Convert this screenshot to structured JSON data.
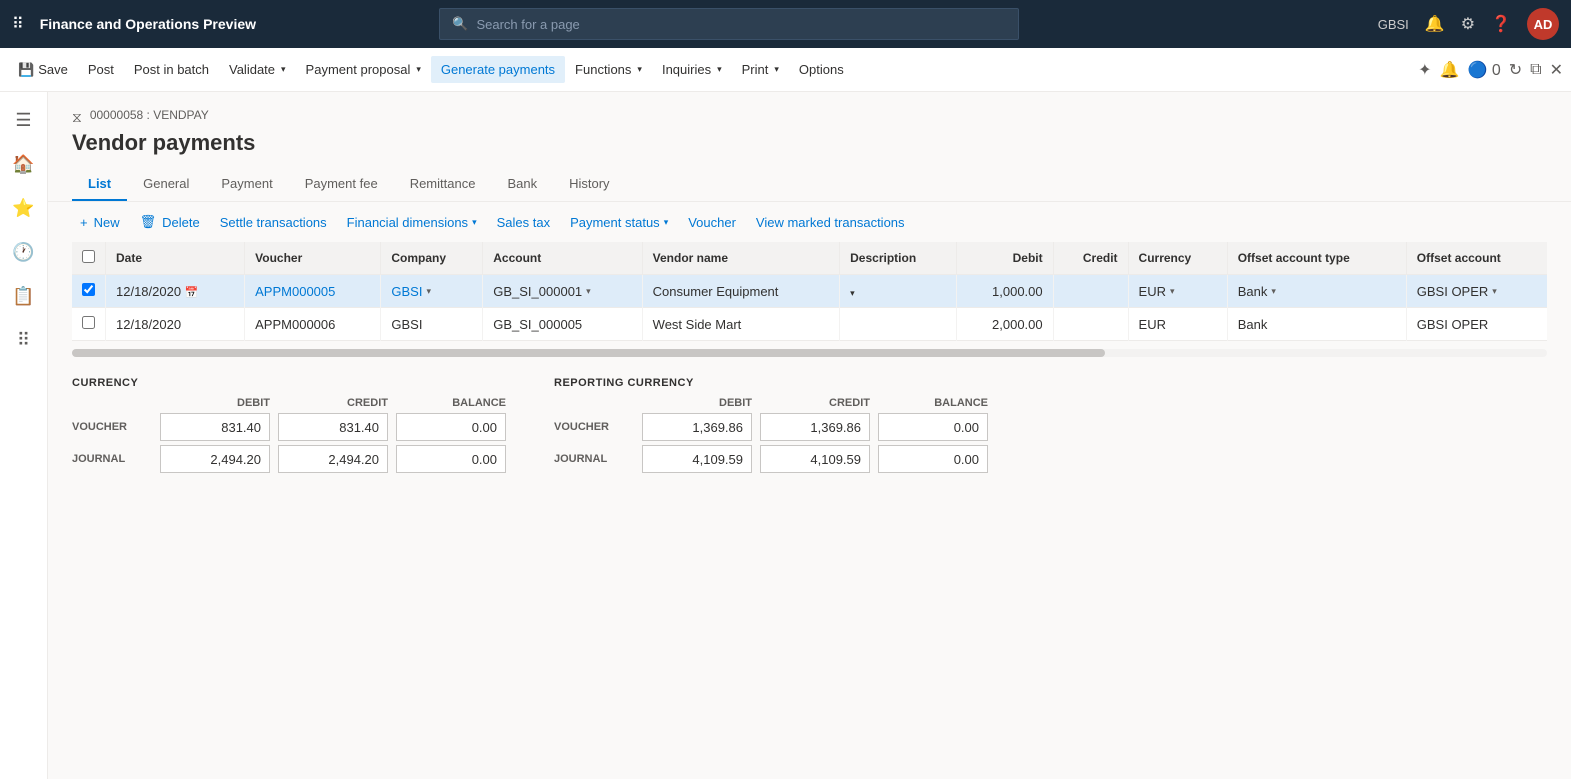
{
  "app": {
    "title": "Finance and Operations Preview",
    "user": "GBSI",
    "avatar": "AD"
  },
  "search": {
    "placeholder": "Search for a page"
  },
  "commandBar": {
    "buttons": [
      {
        "id": "save",
        "label": "Save",
        "icon": "💾"
      },
      {
        "id": "post",
        "label": "Post",
        "icon": ""
      },
      {
        "id": "post-batch",
        "label": "Post in batch",
        "icon": ""
      },
      {
        "id": "validate",
        "label": "Validate",
        "hasDropdown": true
      },
      {
        "id": "payment-proposal",
        "label": "Payment proposal",
        "hasDropdown": true
      },
      {
        "id": "generate-payments",
        "label": "Generate payments",
        "hasDropdown": false,
        "active": true
      },
      {
        "id": "functions",
        "label": "Functions",
        "hasDropdown": true
      },
      {
        "id": "inquiries",
        "label": "Inquiries",
        "hasDropdown": true
      },
      {
        "id": "print",
        "label": "Print",
        "hasDropdown": true
      },
      {
        "id": "options",
        "label": "Options",
        "hasDropdown": false
      }
    ]
  },
  "breadcrumb": "00000058 : VENDPAY",
  "pageTitle": "Vendor payments",
  "tabs": [
    {
      "id": "list",
      "label": "List",
      "active": true
    },
    {
      "id": "general",
      "label": "General"
    },
    {
      "id": "payment",
      "label": "Payment"
    },
    {
      "id": "payment-fee",
      "label": "Payment fee"
    },
    {
      "id": "remittance",
      "label": "Remittance"
    },
    {
      "id": "bank",
      "label": "Bank"
    },
    {
      "id": "history",
      "label": "History"
    }
  ],
  "subToolbar": {
    "newLabel": "+ New",
    "deleteLabel": "🗑 Delete",
    "settleTransactions": "Settle transactions",
    "financialDimensions": "Financial dimensions",
    "salesTax": "Sales tax",
    "paymentStatus": "Payment status",
    "voucher": "Voucher",
    "viewMarked": "View marked transactions"
  },
  "table": {
    "columns": [
      {
        "id": "check",
        "label": ""
      },
      {
        "id": "date",
        "label": "Date"
      },
      {
        "id": "voucher",
        "label": "Voucher"
      },
      {
        "id": "company",
        "label": "Company"
      },
      {
        "id": "account",
        "label": "Account"
      },
      {
        "id": "vendor-name",
        "label": "Vendor name"
      },
      {
        "id": "description",
        "label": "Description"
      },
      {
        "id": "debit",
        "label": "Debit",
        "numeric": true
      },
      {
        "id": "credit",
        "label": "Credit",
        "numeric": true
      },
      {
        "id": "currency",
        "label": "Currency"
      },
      {
        "id": "offset-account-type",
        "label": "Offset account type"
      },
      {
        "id": "offset-account",
        "label": "Offset account"
      }
    ],
    "rows": [
      {
        "selected": true,
        "date": "12/18/2020",
        "voucher": "APPM000005",
        "company": "GBSI",
        "account": "GB_SI_000001",
        "vendorName": "Consumer Equipment",
        "description": "",
        "debit": "1,000.00",
        "credit": "",
        "currency": "EUR",
        "offsetAccountType": "Bank",
        "offsetAccount": "GBSI OPER"
      },
      {
        "selected": false,
        "date": "12/18/2020",
        "voucher": "APPM000006",
        "company": "GBSI",
        "account": "GB_SI_000005",
        "vendorName": "West Side Mart",
        "description": "",
        "debit": "2,000.00",
        "credit": "",
        "currency": "EUR",
        "offsetAccountType": "Bank",
        "offsetAccount": "GBSI OPER"
      }
    ]
  },
  "currency": {
    "sectionTitle": "CURRENCY",
    "headers": [
      "DEBIT",
      "CREDIT",
      "BALANCE"
    ],
    "rows": [
      {
        "label": "VOUCHER",
        "debit": "831.40",
        "credit": "831.40",
        "balance": "0.00"
      },
      {
        "label": "JOURNAL",
        "debit": "2,494.20",
        "credit": "2,494.20",
        "balance": "0.00"
      }
    ]
  },
  "reportingCurrency": {
    "sectionTitle": "REPORTING CURRENCY",
    "headers": [
      "DEBIT",
      "CREDIT",
      "BALANCE"
    ],
    "rows": [
      {
        "label": "VOUCHER",
        "debit": "1,369.86",
        "credit": "1,369.86",
        "balance": "0.00"
      },
      {
        "label": "JOURNAL",
        "debit": "4,109.59",
        "credit": "4,109.59",
        "balance": "0.00"
      }
    ]
  },
  "sidebar": {
    "icons": [
      "☰",
      "🏠",
      "⭐",
      "🕐",
      "📋",
      "☰"
    ]
  }
}
